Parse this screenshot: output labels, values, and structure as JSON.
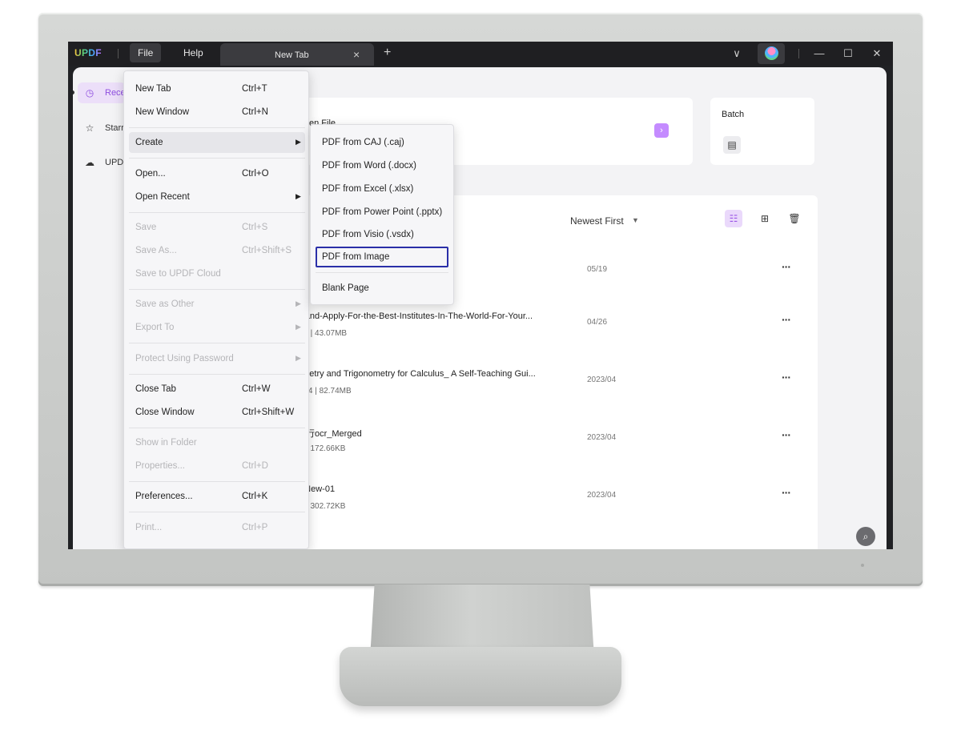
{
  "app": {
    "logo": "UPDF",
    "menu": {
      "file": "File",
      "help": "Help"
    },
    "tab": {
      "label": "New Tab",
      "close": "×",
      "new": "+"
    },
    "window_controls": {
      "dropdown": "∨",
      "minimize": "—",
      "maximize": "☐",
      "close": "✕"
    }
  },
  "sidebar": {
    "items": [
      {
        "label": "Rece",
        "icon": "clock-icon",
        "active": true
      },
      {
        "label": "Starr",
        "icon": "star-icon",
        "active": false
      },
      {
        "label": "UPD",
        "icon": "cloud-icon",
        "active": false
      }
    ]
  },
  "open_file": {
    "label": "en File",
    "button": "›"
  },
  "batch": {
    "label": "Batch"
  },
  "list": {
    "sort": "Newest First",
    "files": [
      {
        "name": "",
        "meta": "",
        "date": "05/19"
      },
      {
        "name": "d-and-Apply-For-the-Best-Institutes-In-The-World-For-Your...",
        "meta": "/30  |  43.07MB",
        "date": "04/26"
      },
      {
        "name": "ometry and Trigonometry for Calculus_ A Self-Teaching Gui...",
        "meta": "/434  |  82.74MB",
        "date": "2023/04"
      },
      {
        "name": "执行ocr_Merged",
        "meta": "/4  |  172.66KB",
        "date": "2023/04"
      },
      {
        "name": "s-New-01",
        "meta": "/2  |  302.72KB",
        "date": "2023/04"
      }
    ]
  },
  "file_menu": {
    "items": [
      {
        "label": "New Tab",
        "shortcut": "Ctrl+T"
      },
      {
        "label": "New Window",
        "shortcut": "Ctrl+N"
      },
      {
        "label": "Create",
        "shortcut": ""
      },
      {
        "label": "Open...",
        "shortcut": "Ctrl+O"
      },
      {
        "label": "Open Recent",
        "shortcut": ""
      },
      {
        "label": "Save",
        "shortcut": "Ctrl+S"
      },
      {
        "label": "Save As...",
        "shortcut": "Ctrl+Shift+S"
      },
      {
        "label": "Save to UPDF Cloud",
        "shortcut": ""
      },
      {
        "label": "Save as Other",
        "shortcut": ""
      },
      {
        "label": "Export To",
        "shortcut": ""
      },
      {
        "label": "Protect Using Password",
        "shortcut": ""
      },
      {
        "label": "Close Tab",
        "shortcut": "Ctrl+W"
      },
      {
        "label": "Close Window",
        "shortcut": "Ctrl+Shift+W"
      },
      {
        "label": "Show in Folder",
        "shortcut": ""
      },
      {
        "label": "Properties...",
        "shortcut": "Ctrl+D"
      },
      {
        "label": "Preferences...",
        "shortcut": "Ctrl+K"
      },
      {
        "label": "Print...",
        "shortcut": "Ctrl+P"
      }
    ]
  },
  "create_submenu": {
    "items": [
      "PDF from CAJ (.caj)",
      "PDF from Word (.docx)",
      "PDF from Excel (.xlsx)",
      "PDF from Power Point (.pptx)",
      "PDF from Visio (.vsdx)",
      "PDF from Image",
      "Blank Page"
    ]
  },
  "colors": {
    "accent": "#9b55e6",
    "highlight_border": "#2a2fa8"
  }
}
